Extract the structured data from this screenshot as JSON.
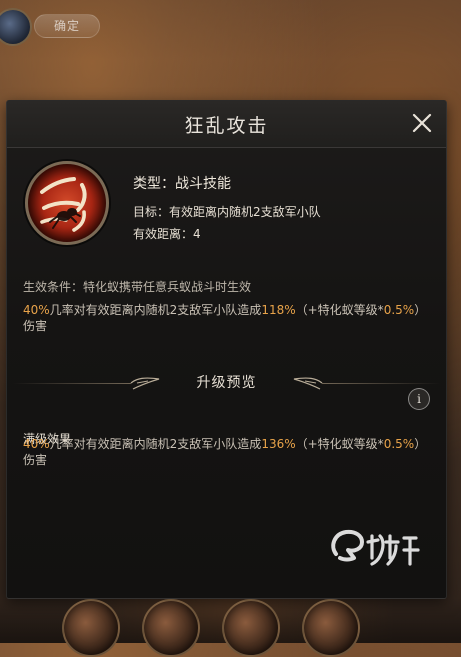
{
  "top_bar": {
    "pill_label": "确定"
  },
  "dialog": {
    "title": "狂乱攻击",
    "skill": {
      "type_text": "类型：战斗技能",
      "target_text": "目标：有效距离内随机2支敌军小队",
      "range_text": "有效距离：4"
    },
    "condition_text": "生效条件：特化蚁携带任意兵蚁战斗时生效",
    "current_effect": {
      "prefix": "40%",
      "middle": "几率对有效距离内随机2支敌军小队造成",
      "value": "118%",
      "suffix": "（+特化蚁等级*",
      "scale": "0.5%",
      "end": "）伤害"
    },
    "upgrade_section_title": "升级预览",
    "max_level_label": "满级效果",
    "max_effect": {
      "prefix": "40%",
      "middle": "几率对有效距离内随机2支敌军小队造成",
      "value": "136%",
      "suffix": "（+特化蚁等级*",
      "scale": "0.5%",
      "end": "）伤害"
    },
    "info_glyph": "i"
  },
  "icons": {
    "close": "close-icon",
    "skill": "ant-claw-skill-icon",
    "ornament_left": "wing-ornament-left",
    "ornament_right": "wing-ornament-right",
    "info": "info-icon"
  },
  "colors": {
    "accent_orange": "#e8a34a",
    "panel_bg": "#151413",
    "text_primary": "#e6dfd3"
  }
}
